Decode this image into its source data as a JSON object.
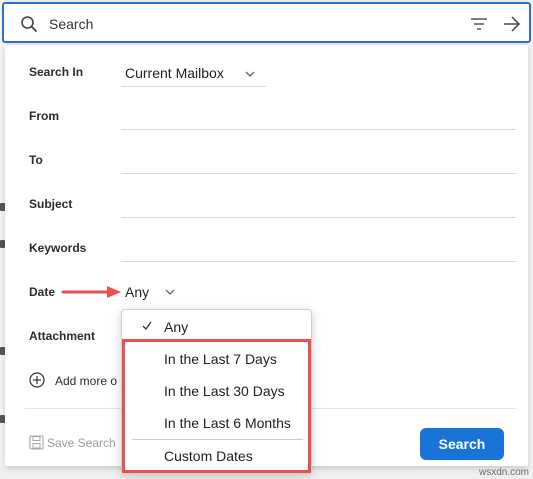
{
  "search_bar": {
    "placeholder": "Search",
    "icons": [
      "search-icon",
      "filter-icon",
      "arrow-right-icon"
    ]
  },
  "form": {
    "search_in": {
      "label": "Search In",
      "value": "Current Mailbox"
    },
    "from": {
      "label": "From",
      "value": ""
    },
    "to": {
      "label": "To",
      "value": ""
    },
    "subject": {
      "label": "Subject",
      "value": ""
    },
    "keywords": {
      "label": "Keywords",
      "value": ""
    },
    "date": {
      "label": "Date",
      "value": "Any"
    },
    "attachment": {
      "label": "Attachment"
    },
    "add_more_label": "Add more o",
    "save_search_label": "Save Search",
    "search_button_label": "Search"
  },
  "date_dropdown": {
    "items": [
      {
        "label": "Any",
        "checked": true
      },
      {
        "label": "In the Last 7 Days",
        "checked": false
      },
      {
        "label": "In the Last 30 Days",
        "checked": false
      },
      {
        "label": "In the Last 6 Months",
        "checked": false
      },
      {
        "label": "Custom Dates",
        "checked": false
      }
    ]
  },
  "annotation": {
    "arrow_color": "#e6524c",
    "highlight_color": "#e6524c"
  },
  "colors": {
    "accent": "#1a73d9",
    "search_border": "#2a6fcf"
  },
  "watermark": "wsxdn.com"
}
